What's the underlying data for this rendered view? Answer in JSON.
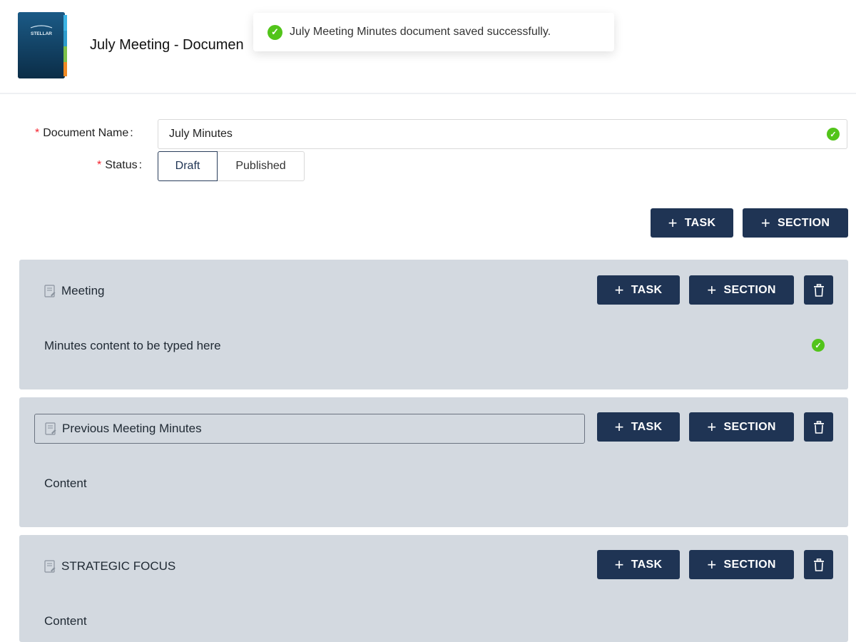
{
  "header": {
    "title": "July Meeting - Documen",
    "logo_text": "STELLAR"
  },
  "toast": {
    "icon": "check-circle-icon",
    "message": "July Meeting Minutes document saved successfully."
  },
  "form": {
    "name_label": "Document Name",
    "name_value": "July Minutes",
    "status_label": "Status",
    "status_options": [
      "Draft",
      "Published"
    ],
    "status_selected": "Draft",
    "required_mark": "*",
    "colon": ":"
  },
  "toolbar": {
    "task_label": "TASK",
    "section_label": "SECTION"
  },
  "sections": [
    {
      "title": "Meeting",
      "content": "Minutes content to be typed here",
      "content_valid": true,
      "editing": false
    },
    {
      "title": "Previous Meeting Minutes",
      "content": "Content",
      "content_valid": false,
      "editing": true
    },
    {
      "title": "STRATEGIC FOCUS",
      "content": "Content",
      "content_valid": false,
      "editing": false
    }
  ],
  "colors": {
    "primary": "#1f3454",
    "section_bg": "#d3d9e0",
    "success": "#52c41a",
    "required": "#f5222d"
  }
}
